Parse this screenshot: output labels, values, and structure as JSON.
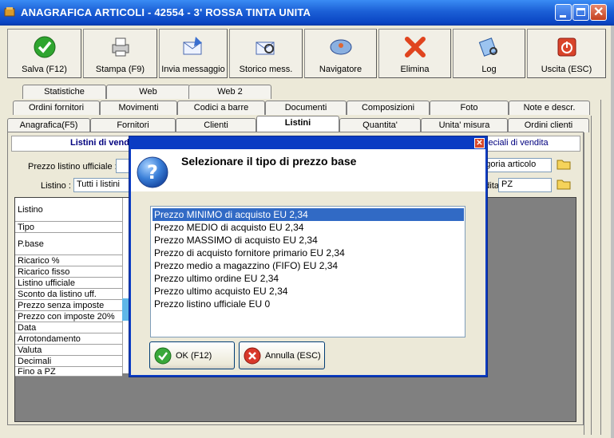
{
  "window": {
    "title": "ANAGRAFICA ARTICOLI - 42554 - 3' ROSSA TINTA UNITA"
  },
  "toolbar": [
    {
      "label": "Salva (F12)",
      "icon": "check-icon"
    },
    {
      "label": "Stampa (F9)",
      "icon": "printer-icon"
    },
    {
      "label": "Invia messaggio",
      "icon": "send-message-icon"
    },
    {
      "label": "Storico mess.",
      "icon": "message-history-icon"
    },
    {
      "label": "Navigatore",
      "icon": "navigator-icon"
    },
    {
      "label": "Elimina",
      "icon": "delete-x-icon"
    },
    {
      "label": "Log",
      "icon": "log-icon"
    },
    {
      "label": "Uscita (ESC)",
      "icon": "exit-icon"
    }
  ],
  "tabs": {
    "row1": [
      "Statistiche",
      "Web",
      "Web 2"
    ],
    "row2": [
      "Ordini fornitori",
      "Movimenti",
      "Codici a barre",
      "Documenti",
      "Composizioni",
      "Foto",
      "Note e descr."
    ],
    "row3": [
      "Anagrafica(F5)",
      "Fornitori",
      "Clienti",
      "Listini",
      "Quantita'",
      "Unita' misura",
      "Ordini clienti"
    ],
    "active": "Listini"
  },
  "panel": {
    "section_left": "Listini di vendita",
    "section_right": "Speciali di vendita",
    "prezzo_listino_label": "Prezzo listino ufficiale :",
    "listino_label": "Listino :",
    "listino_value": "Tutti i listini",
    "categoria_value": "Categoria articolo",
    "um_label": "U.m. vendita :",
    "um_value": "PZ",
    "rows": [
      "Listino",
      "Tipo",
      "P.base",
      "Ricarico %",
      "Ricarico fisso",
      "Listino ufficiale",
      "Sconto da listino uff.",
      "Prezzo senza imposte",
      "Prezzo con imposte 20%",
      "Data",
      "Arrotondamento",
      "Valuta",
      "Decimali",
      "Fino a PZ"
    ]
  },
  "dialog": {
    "heading": "Selezionare il tipo di prezzo base",
    "options": [
      "Prezzo MINIMO di acquisto EU 2,34",
      "Prezzo MEDIO di acquisto EU 2,34",
      "Prezzo MASSIMO di acquisto EU 2,34",
      "Prezzo di acquisto fornitore primario EU 2,34",
      "Prezzo medio a magazzino (FIFO) EU 2,34",
      "Prezzo ultimo ordine EU 2,34",
      "Prezzo ultimo acquisto EU 2,34",
      "Prezzo listino ufficiale EU 0"
    ],
    "selected_index": 0,
    "ok_label": "OK (F12)",
    "cancel_label": "Annulla (ESC)"
  },
  "colors": {
    "titlebar": "#0a45c3",
    "selection": "#316ac5",
    "section_title": "#00007f"
  }
}
